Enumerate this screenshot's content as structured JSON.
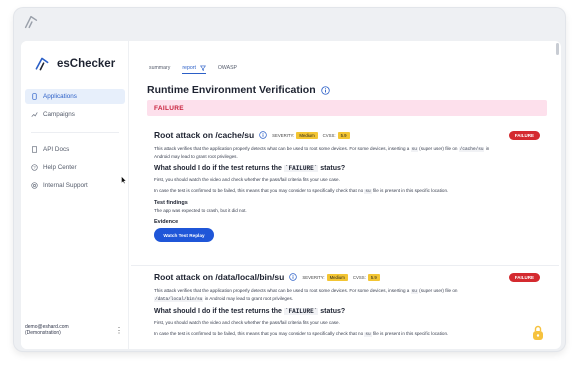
{
  "app": {
    "brand_name": "esChecker"
  },
  "sidebar": {
    "items": [
      {
        "label": "Applications",
        "icon": "phone-icon",
        "active": true
      },
      {
        "label": "Campaigns",
        "icon": "chart-icon",
        "active": false
      }
    ],
    "items2": [
      {
        "label": "API Docs",
        "icon": "doc-icon"
      },
      {
        "label": "Help Center",
        "icon": "help-icon"
      },
      {
        "label": "Internal Support",
        "icon": "support-icon"
      }
    ],
    "user_email": "demo@eshard.com",
    "user_org": "(Demonstration)"
  },
  "tabs": [
    {
      "label": "summary"
    },
    {
      "label": "report"
    },
    {
      "label": "OWASP"
    }
  ],
  "section": {
    "title": "Runtime Environment Verification",
    "status_banner": "FAILURE"
  },
  "cards": [
    {
      "title": "Root attack on /cache/su",
      "severity_label": "SEVERITY:",
      "severity": "Medium",
      "cvss_label": "CVSS:",
      "cvss": "5.9",
      "status": "FAILURE",
      "desc_a": "This attack verifies that the application properly detects what can be used to root some devices. For some devices, inserting a ",
      "desc_code1": "su",
      "desc_b": " (super user) file on ",
      "desc_code2": "/cache/su",
      "desc_c": " in",
      "desc_line2": "Android may lead to grant root privileges.",
      "q_title_a": "What should I do if the test returns the ",
      "q_title_code": "`FAILURE`",
      "q_title_b": " status?",
      "p1": "First, you should watch the video and check whether the pass/fail criteria fits your use case.",
      "p2_a": "In case the test is confirmed to be failed, this means that you may consider to specifically check that no ",
      "p2_code": "su",
      "p2_b": " file is present in this specific location.",
      "findings_title": "Test findings",
      "findings_text": "The app was expected to crash, but it did not.",
      "evidence_title": "Evidence",
      "replay_label": "Watch Test Replay"
    },
    {
      "title": "Root attack on /data/local/bin/su",
      "severity_label": "SEVERITY:",
      "severity": "Medium",
      "cvss_label": "CVSS:",
      "cvss": "5.9",
      "status": "FAILURE",
      "desc_a": "This attack verifies that the application properly detects what can be used to root some devices. For some devices, inserting a ",
      "desc_code1": "su",
      "desc_b": " (super user) file on",
      "desc_code2": "/data/local/bin/su",
      "desc_c": " in Android may lead to grant root privileges.",
      "q_title_a": "What should I do if the test returns the ",
      "q_title_code": "`FAILURE`",
      "q_title_b": " status?",
      "p1": "First, you should watch the video and check whether the pass/fail criteria fits your use case.",
      "p2_a": "In case the test is confirmed to be failed, this means that you may consider to specifically check that no ",
      "p2_code": "su",
      "p2_b": " file is present in this specific location."
    }
  ],
  "colors": {
    "accent": "#1f56d8",
    "failure": "#d42a2f",
    "banner_bg": "#fde0ec",
    "severity_badge": "#f3c533"
  }
}
